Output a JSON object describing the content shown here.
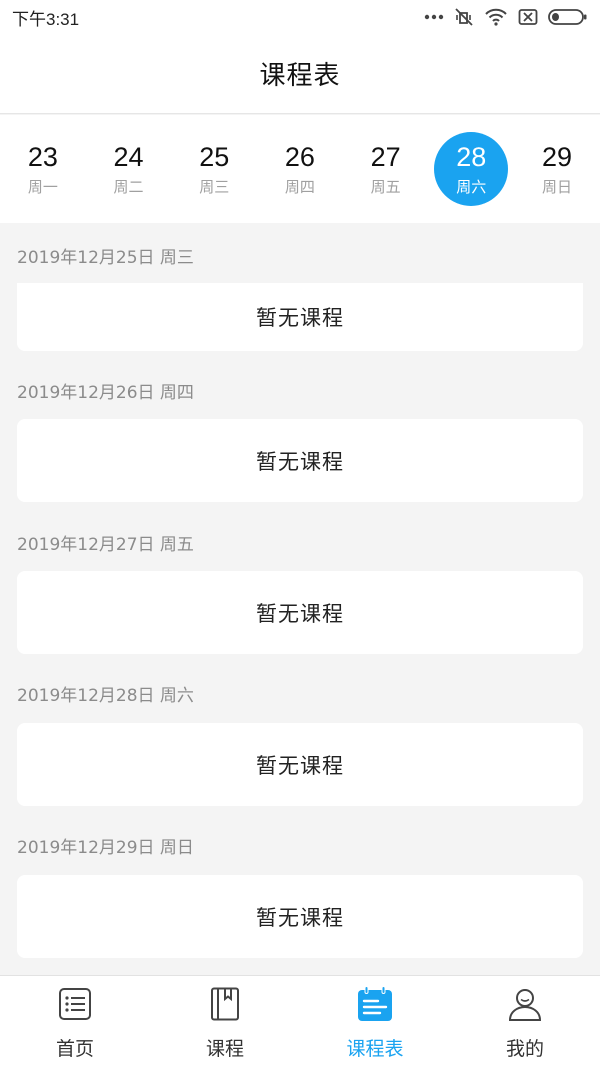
{
  "status_bar": {
    "time": "下午3:31",
    "icons": [
      "more-dots-icon",
      "vibrate-off-icon",
      "wifi-icon",
      "sim-off-icon",
      "battery-icon"
    ]
  },
  "header": {
    "title": "课程表"
  },
  "week": {
    "days": [
      {
        "num": "23",
        "label": "周一"
      },
      {
        "num": "24",
        "label": "周二"
      },
      {
        "num": "25",
        "label": "周三"
      },
      {
        "num": "26",
        "label": "周四"
      },
      {
        "num": "27",
        "label": "周五"
      },
      {
        "num": "28",
        "label": "周六"
      },
      {
        "num": "29",
        "label": "周日"
      }
    ],
    "selected_index": 5,
    "accent_color": "#1aa3f0"
  },
  "schedule": {
    "sections": [
      {
        "date": "2019年12月25日 周三",
        "empty_text": "暂无课程"
      },
      {
        "date": "2019年12月26日 周四",
        "empty_text": "暂无课程"
      },
      {
        "date": "2019年12月27日 周五",
        "empty_text": "暂无课程"
      },
      {
        "date": "2019年12月28日 周六",
        "empty_text": "暂无课程"
      },
      {
        "date": "2019年12月29日 周日",
        "empty_text": "暂无课程"
      }
    ]
  },
  "bottom_nav": {
    "items": [
      {
        "label": "首页",
        "icon": "home-list-icon"
      },
      {
        "label": "课程",
        "icon": "book-icon"
      },
      {
        "label": "课程表",
        "icon": "calendar-icon"
      },
      {
        "label": "我的",
        "icon": "profile-icon"
      }
    ],
    "active_index": 2
  }
}
